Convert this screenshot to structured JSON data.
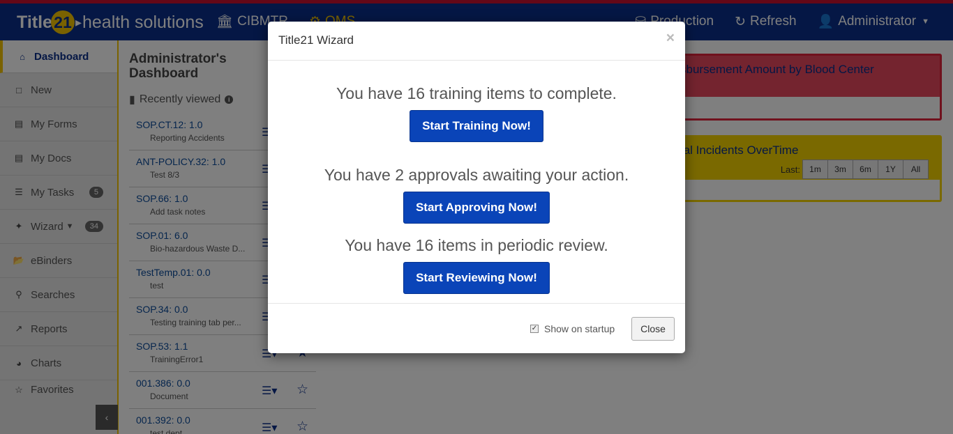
{
  "header": {
    "brand_t": "Title",
    "brand_num": "21",
    "brand_rest": "health solutions",
    "nav_left": [
      {
        "label": "CIBMTR",
        "icon": "bank-icon"
      },
      {
        "label": "QMS",
        "icon": "gear-icon"
      }
    ],
    "nav_right": [
      {
        "label": "Production",
        "icon": "database-icon"
      },
      {
        "label": "Refresh",
        "icon": "refresh-icon"
      },
      {
        "label": "Administrator",
        "icon": "user-icon"
      }
    ]
  },
  "sidebar": {
    "items": [
      {
        "label": "Dashboard",
        "icon": "home-icon"
      },
      {
        "label": "New",
        "icon": "file-icon"
      },
      {
        "label": "My Forms",
        "icon": "form-icon"
      },
      {
        "label": "My Docs",
        "icon": "doc-icon"
      },
      {
        "label": "My Tasks",
        "icon": "tasks-icon",
        "badge": "5"
      },
      {
        "label": "Wizard",
        "icon": "wand-icon",
        "badge": "34"
      },
      {
        "label": "eBinders",
        "icon": "folder-icon"
      },
      {
        "label": "Searches",
        "icon": "search-icon"
      },
      {
        "label": "Reports",
        "icon": "line-chart-icon"
      },
      {
        "label": "Charts",
        "icon": "pie-chart-icon"
      },
      {
        "label": "Favorites",
        "icon": "star-icon"
      }
    ]
  },
  "main": {
    "title_line1": "Administrator's",
    "title_line2": "Dashboard",
    "recent_label": "Recently viewed",
    "recent": [
      {
        "code": "SOP.CT.12: 1.0",
        "desc": "Reporting Accidents"
      },
      {
        "code": "ANT-POLICY.32: 1.0",
        "desc": "Test 8/3"
      },
      {
        "code": "SOP.66: 1.0",
        "desc": "Add task notes"
      },
      {
        "code": "SOP.01: 6.0",
        "desc": "Bio-hazardous Waste D..."
      },
      {
        "code": "TestTemp.01: 0.0",
        "desc": "test"
      },
      {
        "code": "SOP.34: 0.0",
        "desc": "Testing training tab per..."
      },
      {
        "code": "SOP.53: 1.1",
        "desc": "TrainingError1"
      },
      {
        "code": "001.386: 0.0",
        "desc": "Document"
      },
      {
        "code": "001.392: 0.0",
        "desc": "test dept"
      }
    ]
  },
  "panels": {
    "red_title": "sbursement Amount by Blood Center",
    "yellow_title": "tal Incidents OverTime",
    "range_label": "Last:",
    "ranges": [
      "1m",
      "3m",
      "6m",
      "1Y",
      "All"
    ]
  },
  "modal": {
    "title": "Title21 Wizard",
    "close_x": "×",
    "training_msg": "You have 16 training items to complete.",
    "training_btn": "Start Training Now!",
    "approval_msg": "You have 2 approvals awaiting your action.",
    "approval_btn": "Start Approving Now!",
    "review_msg": "You have 16 items in periodic review.",
    "review_btn": "Start Reviewing Now!",
    "show_startup": "Show on startup",
    "show_startup_checked": true,
    "close_btn": "Close"
  },
  "colors": {
    "header_bg": "#0a2f8a",
    "accent_yellow": "#f5c400",
    "primary_button": "#0a44b8",
    "panel_red": "#e8485e",
    "panel_yellow": "#f5d300"
  }
}
